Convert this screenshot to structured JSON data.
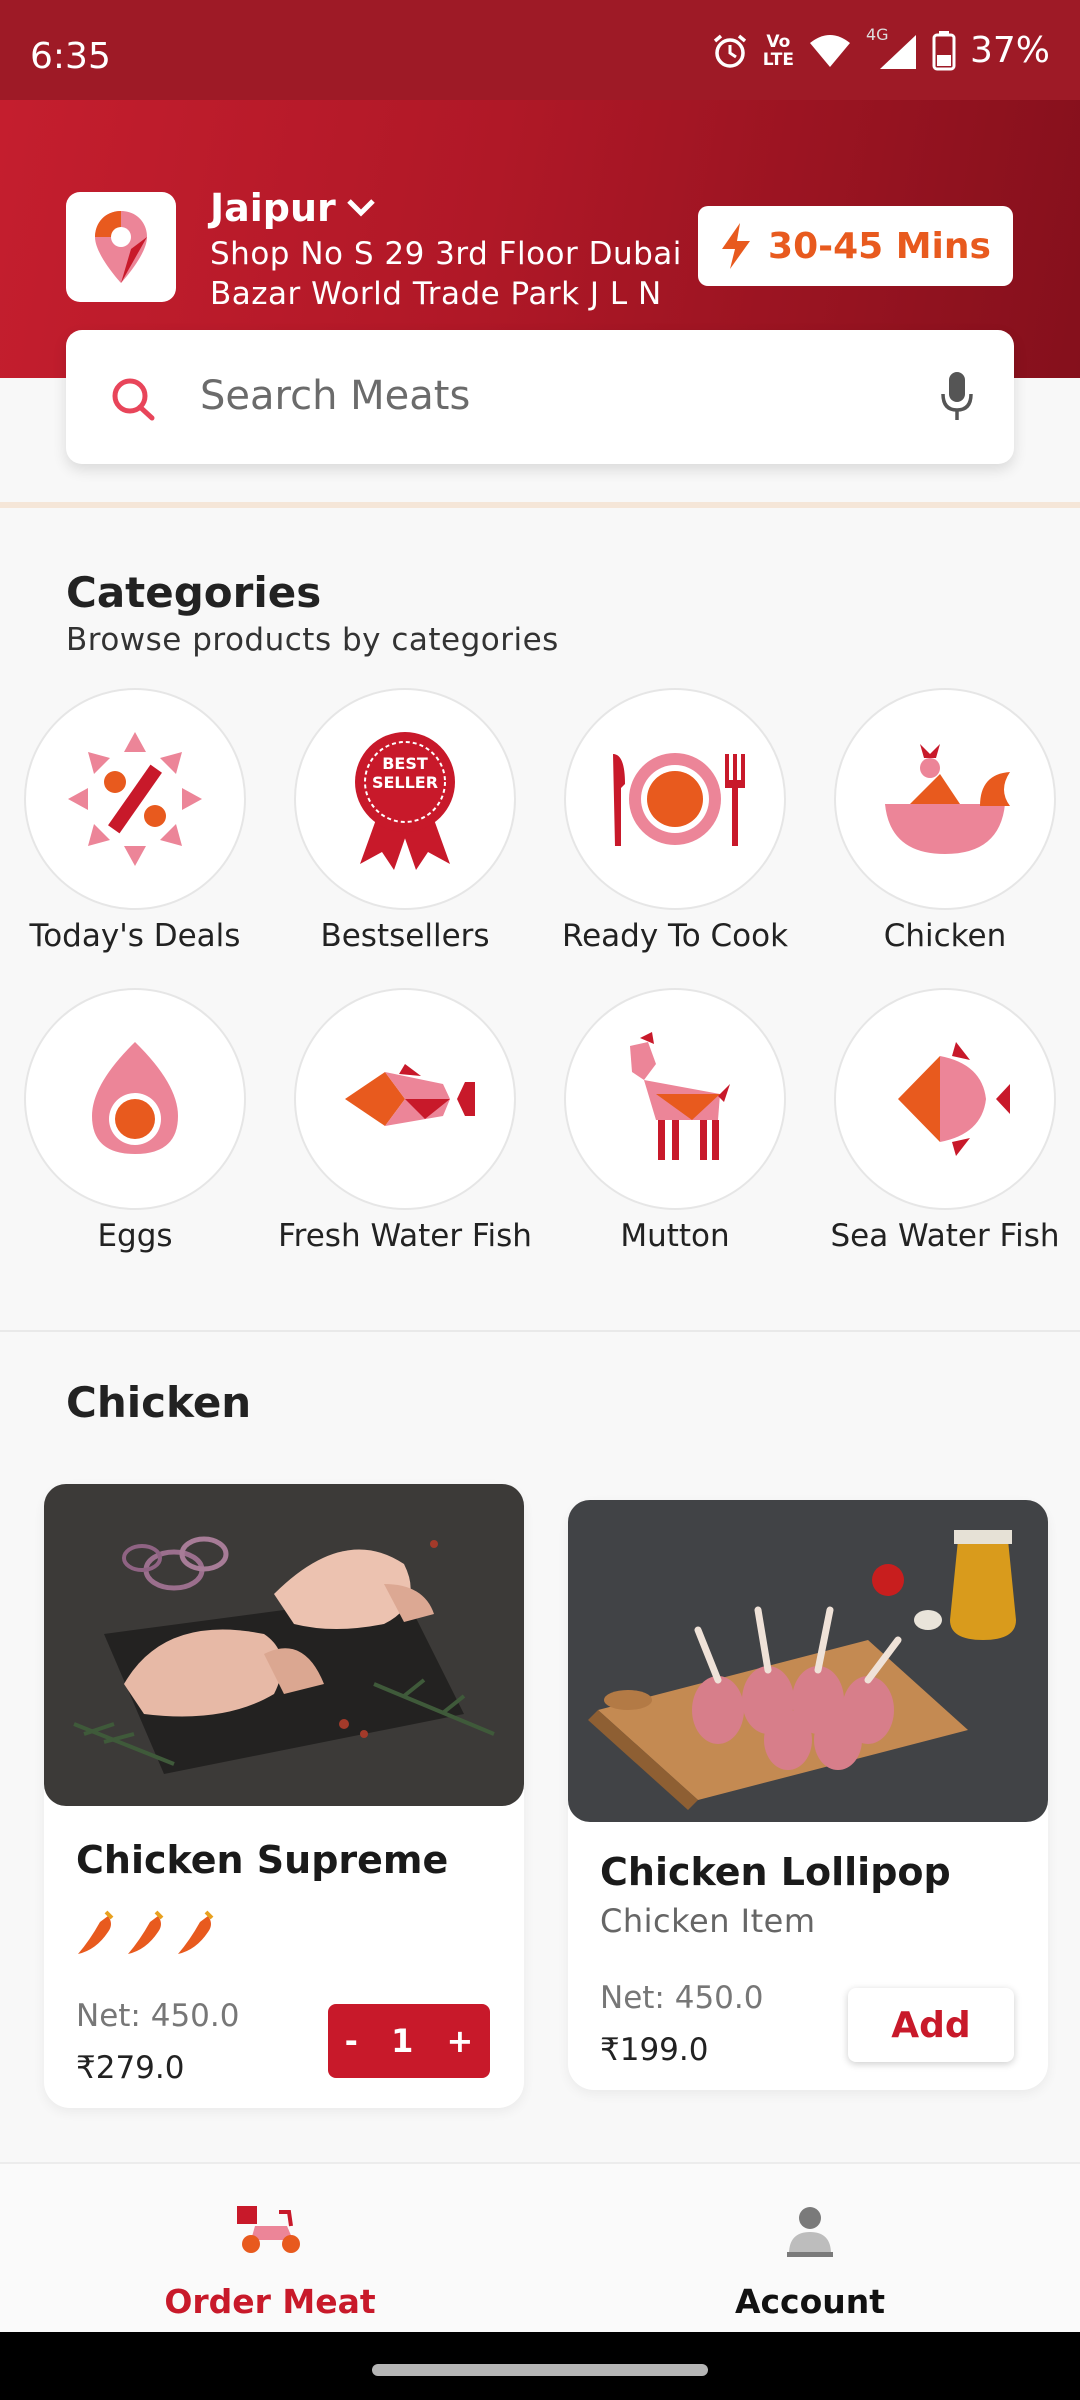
{
  "status_bar": {
    "time": "6:35",
    "lte_top": "Vo",
    "lte_bottom": "LTE",
    "network": "4G",
    "battery": "37%"
  },
  "header": {
    "city": "Jaipur",
    "address": "Shop No S 29 3rd Floor Dubai Bazar World Trade Park J L N",
    "eta": "30-45 Mins"
  },
  "search": {
    "placeholder": "Search Meats"
  },
  "categories": {
    "title": "Categories",
    "subtitle": "Browse products by categories",
    "items": [
      {
        "label": "Today's Deals",
        "icon": "deals-icon"
      },
      {
        "label": "Bestsellers",
        "icon": "best-seller-badge-icon",
        "badge_line1": "BEST",
        "badge_line2": "SELLER"
      },
      {
        "label": "Ready To Cook",
        "icon": "plate-cutlery-icon"
      },
      {
        "label": "Chicken",
        "icon": "chicken-icon"
      },
      {
        "label": "Eggs",
        "icon": "egg-icon"
      },
      {
        "label": "Fresh Water Fish",
        "icon": "fresh-water-fish-icon"
      },
      {
        "label": "Mutton",
        "icon": "goat-icon"
      },
      {
        "label": "Sea Water Fish",
        "icon": "sea-water-fish-icon"
      }
    ]
  },
  "chicken_section": {
    "title": "Chicken",
    "products": [
      {
        "name": "Chicken Supreme",
        "spice_level": 3,
        "net": "Net: 450.0",
        "price": "₹279.0",
        "quantity": "1",
        "minus": "-",
        "plus": "+"
      },
      {
        "name": "Chicken Lollipop",
        "subtitle": "Chicken Item",
        "net": "Net: 450.0",
        "price": "₹199.0",
        "add_label": "Add"
      }
    ]
  },
  "bottom_nav": {
    "items": [
      {
        "label": "Order Meat",
        "active": true
      },
      {
        "label": "Account",
        "active": false
      }
    ]
  },
  "colors": {
    "brand_red": "#c8192a",
    "accent_orange": "#e85a1e",
    "pink": "#ec8598",
    "header_dark": "#9e1a26"
  }
}
